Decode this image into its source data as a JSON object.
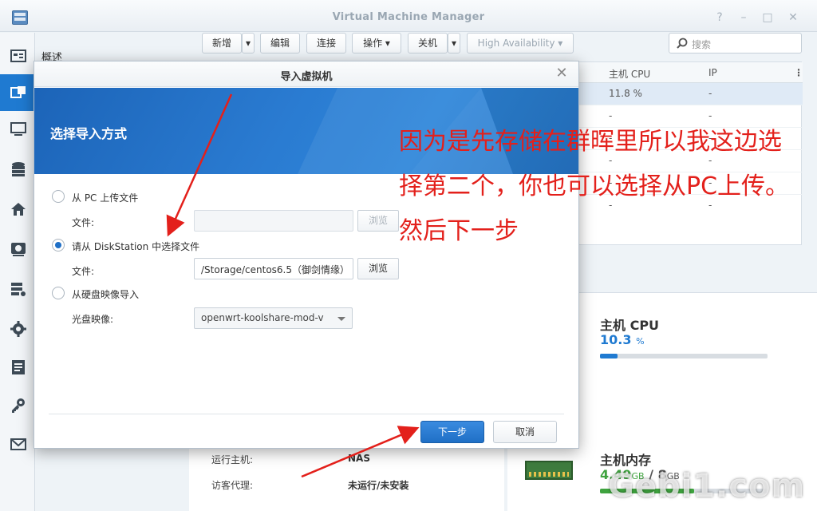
{
  "app": {
    "title": "Virtual Machine Manager",
    "window_controls": [
      "?",
      "–",
      "□",
      "✕"
    ]
  },
  "sidebar": {
    "items": [
      {
        "icon": "overview-icon",
        "label": "概述"
      },
      {
        "icon": "vm-icon",
        "label": ""
      },
      {
        "icon": "host-icon",
        "label": ""
      },
      {
        "icon": "storage-icon",
        "label": ""
      },
      {
        "icon": "network-icon",
        "label": ""
      },
      {
        "icon": "image-icon",
        "label": ""
      },
      {
        "icon": "cluster-icon",
        "label": ""
      },
      {
        "icon": "settings-icon",
        "label": ""
      },
      {
        "icon": "log-icon",
        "label": ""
      },
      {
        "icon": "license-icon",
        "label": ""
      },
      {
        "icon": "notification-icon",
        "label": ""
      }
    ]
  },
  "toolbar": {
    "create": "新增",
    "edit": "编辑",
    "connect": "连接",
    "action": "操作 ▾",
    "shutdown": "关机",
    "high_availability": "High Availability ▾",
    "search_placeholder": "搜索"
  },
  "grid": {
    "columns": [
      "主机 CPU",
      "IP"
    ],
    "rows": [
      {
        "cpu": "11.8 %",
        "ip": "-"
      },
      {
        "cpu": "-",
        "ip": "-"
      },
      {
        "cpu": "-",
        "ip": "-"
      },
      {
        "cpu": "-",
        "ip": "-"
      },
      {
        "cpu": "-",
        "ip": "-"
      },
      {
        "cpu": "-",
        "ip": "-"
      }
    ]
  },
  "stats": {
    "cpu_title": "主机 CPU",
    "cpu_value": "10.3",
    "cpu_unit": "%",
    "cpu_percent": 10.3,
    "ram_title": "主机内存",
    "ram_used": "4.49",
    "ram_used_unit": "GB",
    "ram_sep": "/",
    "ram_total": "8",
    "ram_total_unit": "GB",
    "ram_percent": 56
  },
  "info": {
    "host_label": "运行主机:",
    "host_value": "NAS",
    "guest_agent_label": "访客代理:",
    "guest_agent_value": "未运行/未安装"
  },
  "dialog": {
    "title": "导入虚拟机",
    "banner_title": "选择导入方式",
    "option_pc": "从 PC 上传文件",
    "option_pc_file_label": "文件:",
    "option_pc_file_value": "",
    "browse": "浏览",
    "option_ds": "请从 DiskStation 中选择文件",
    "option_ds_file_label": "文件:",
    "option_ds_file_value": "/Storage/centos6.5（御剑情缘）",
    "option_iso": "从硬盘映像导入",
    "option_iso_label": "光盘映像:",
    "option_iso_value": "openwrt-koolshare-mod-v",
    "next": "下一步",
    "cancel": "取消"
  },
  "annotation": {
    "text": "因为是先存储在群晖里所以我这边选择第二个，你也可以选择从PC上传。然后下一步"
  },
  "watermark": "Gebi1.com",
  "colors": {
    "accent": "#1f6fc6",
    "banner": "#2a7bd1",
    "annotation_red": "#e3201b",
    "cpu_bar": "#1f7ad1",
    "ram_bar": "#3fa33f",
    "ram_value": "#3fa33f",
    "cpu_value": "#1f7ad1"
  }
}
